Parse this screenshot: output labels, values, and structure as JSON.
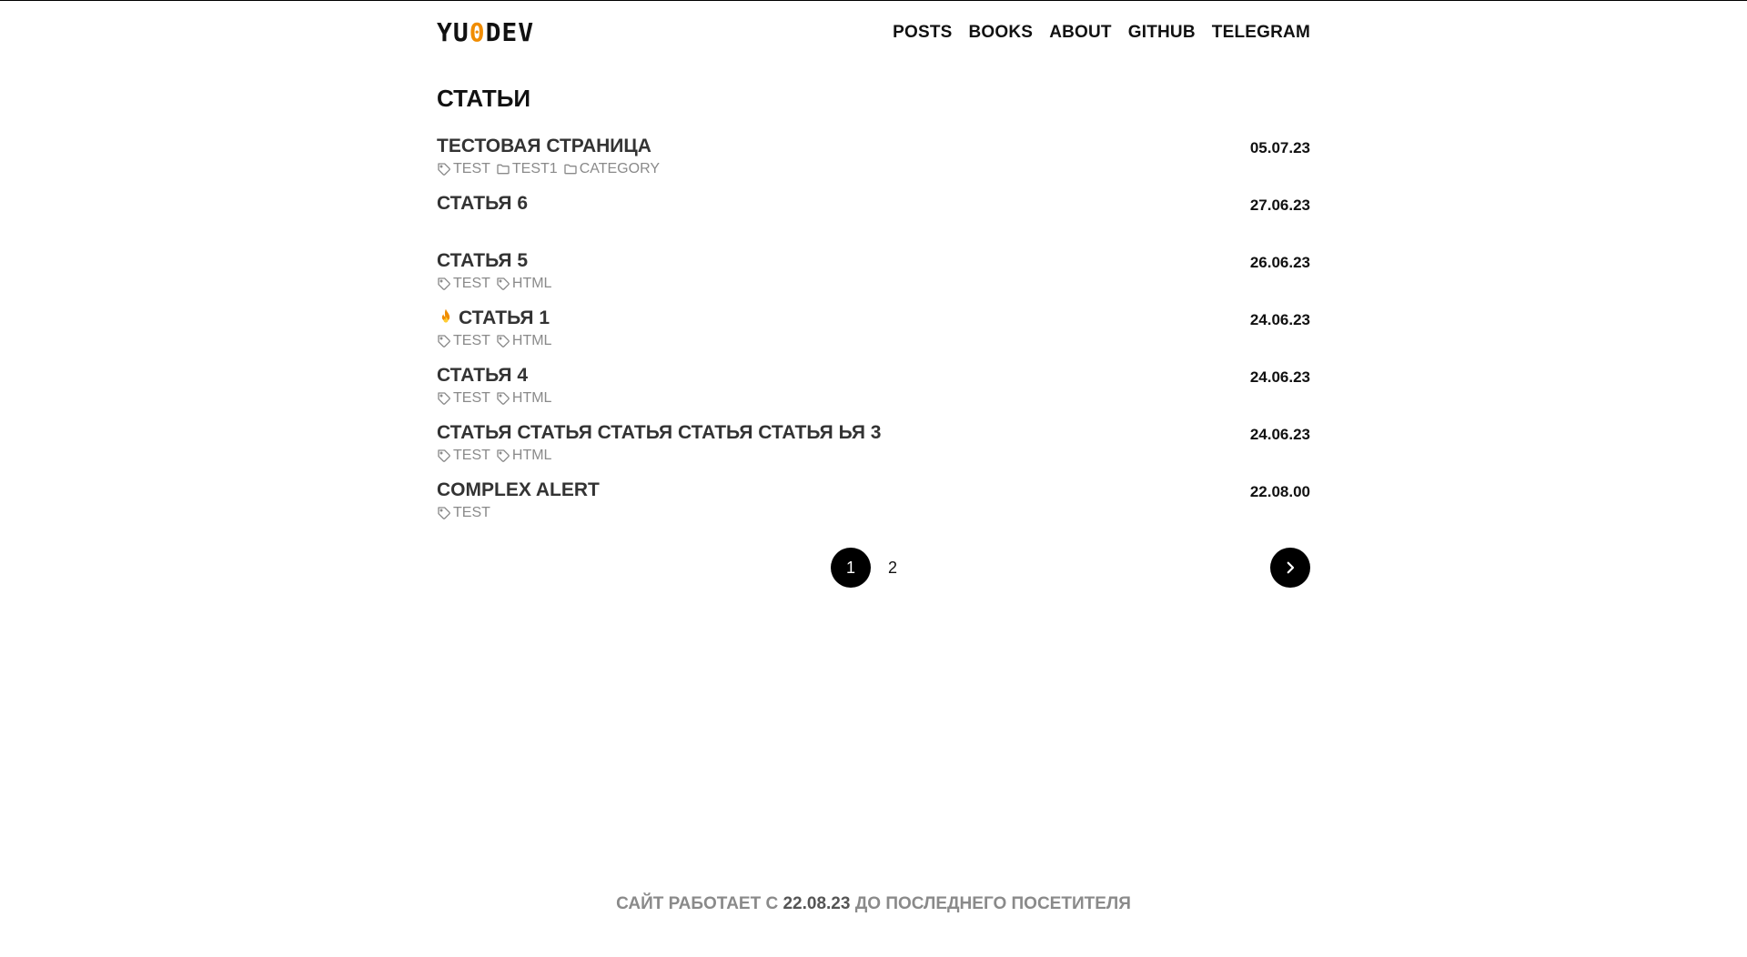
{
  "header": {
    "logo_prefix": "YU",
    "logo_accent": "0",
    "logo_suffix": "DEV",
    "nav": [
      "POSTS",
      "BOOKS",
      "ABOUT",
      "GITHUB",
      "TELEGRAM"
    ]
  },
  "page_title": "СТАТЬИ",
  "posts": [
    {
      "title": "ТЕСТОВАЯ СТРАНИЦА",
      "date": "05.07.23",
      "tags": [
        {
          "type": "tag",
          "label": "TEST"
        },
        {
          "type": "folder",
          "label": "TEST1"
        },
        {
          "type": "folder",
          "label": "CATEGORY"
        }
      ]
    },
    {
      "title": "СТАТЬЯ 6",
      "date": "27.06.23",
      "tags": []
    },
    {
      "title": "СТАТЬЯ 5",
      "date": "26.06.23",
      "tags": [
        {
          "type": "tag",
          "label": "TEST"
        },
        {
          "type": "tag",
          "label": "HTML"
        }
      ]
    },
    {
      "title": "СТАТЬЯ 1",
      "date": "24.06.23",
      "fire": true,
      "tags": [
        {
          "type": "tag",
          "label": "TEST"
        },
        {
          "type": "tag",
          "label": "HTML"
        }
      ]
    },
    {
      "title": "СТАТЬЯ 4",
      "date": "24.06.23",
      "tags": [
        {
          "type": "tag",
          "label": "TEST"
        },
        {
          "type": "tag",
          "label": "HTML"
        }
      ]
    },
    {
      "title": "СТАТЬЯ СТАТЬЯ СТАТЬЯ СТАТЬЯ СТАТЬЯ ЬЯ 3",
      "date": "24.06.23",
      "tags": [
        {
          "type": "tag",
          "label": "TEST"
        },
        {
          "type": "tag",
          "label": "HTML"
        }
      ]
    },
    {
      "title": "COMPLEX ALERT",
      "date": "22.08.00",
      "tags": [
        {
          "type": "tag",
          "label": "TEST"
        }
      ]
    }
  ],
  "pagination": {
    "current": "1",
    "next_page": "2"
  },
  "footer": {
    "prefix": "САЙТ РАБОТАЕТ С",
    "date": "22.08.23",
    "suffix": "ДО ПОСЛЕДНЕГО ПОСЕТИТЕЛЯ"
  },
  "colors": {
    "accent": "#f08c00",
    "muted": "#8a8a8a",
    "text": "#111111"
  }
}
